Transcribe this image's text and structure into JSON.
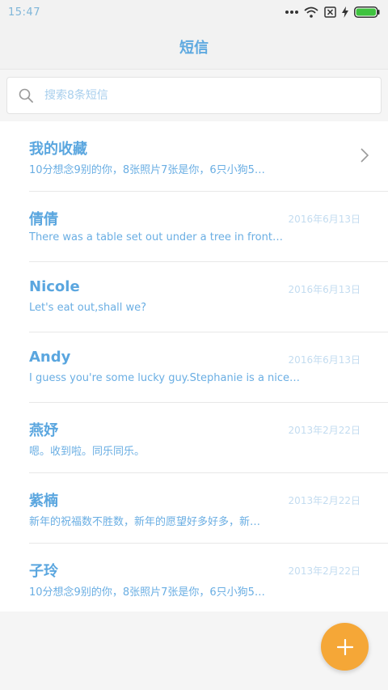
{
  "status_bar": {
    "time": "15:47"
  },
  "header": {
    "title": "短信"
  },
  "search": {
    "placeholder": "搜索8条短信"
  },
  "conversations": [
    {
      "name": "我的收藏",
      "preview": "10分想念9别的你，8张照片7张是你，6只小狗5…",
      "date": "",
      "has_chevron": true
    },
    {
      "name": "倩倩",
      "preview": "There was a table set out under a tree in front…",
      "date": "2016年6月13日"
    },
    {
      "name": "Nicole",
      "preview": "Let's eat out,shall we?",
      "date": "2016年6月13日"
    },
    {
      "name": "Andy",
      "preview": "I guess you're some lucky guy.Stephanie is a nice…",
      "date": "2016年6月13日"
    },
    {
      "name": "燕妤",
      "preview": "嗯。收到啦。同乐同乐。",
      "date": "2013年2月22日"
    },
    {
      "name": "紫楠",
      "preview": "新年的祝福数不胜数，新年的愿望好多好多，新…",
      "date": "2013年2月22日"
    },
    {
      "name": "子玲",
      "preview": "10分想念9别的你，8张照片7张是你，6只小狗5…",
      "date": "2013年2月22日"
    }
  ],
  "fab": {
    "icon": "plus-icon",
    "color": "#f5a737"
  },
  "colors": {
    "accent": "#5aa6df",
    "date": "#c3dcf0",
    "battery": "#3fc33f"
  }
}
